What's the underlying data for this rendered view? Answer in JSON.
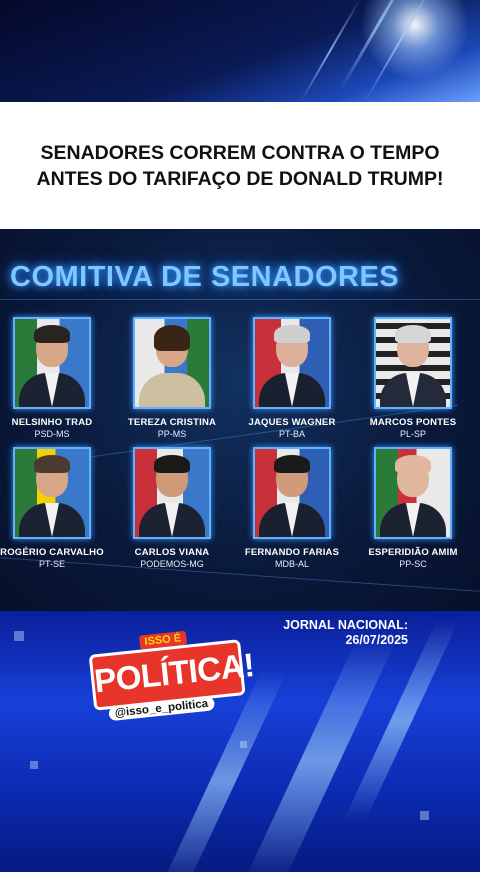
{
  "headline": "SENADORES CORREM CONTRA O TEMPO ANTES DO TARIFAÇO DE DONALD TRUMP!",
  "panel_title": "COMITIVA DE SENADORES",
  "senators": [
    {
      "name": "NELSINHO TRAD",
      "party": "PSD-MS"
    },
    {
      "name": "TEREZA CRISTINA",
      "party": "PP-MS"
    },
    {
      "name": "JAQUES WAGNER",
      "party": "PT-BA"
    },
    {
      "name": "MARCOS PONTES",
      "party": "PL-SP"
    },
    {
      "name": "ROGÉRIO CARVALHO",
      "party": "PT-SE"
    },
    {
      "name": "CARLOS VIANA",
      "party": "PODEMOS-MG"
    },
    {
      "name": "FERNANDO FARIAS",
      "party": "MDB-AL"
    },
    {
      "name": "ESPERIDIÃO AMIM",
      "party": "PP-SC"
    }
  ],
  "broadcast": {
    "program": "JORNAL NACIONAL:",
    "date": "26/07/2025"
  },
  "logo": {
    "kicker": "ISSO É",
    "title": "POLÍTICA!",
    "handle": "@isso_e_politica"
  },
  "colors": {
    "accent_red": "#e8352b",
    "neon_blue": "#7ec8ff",
    "bg_blue": "#1740d8"
  }
}
